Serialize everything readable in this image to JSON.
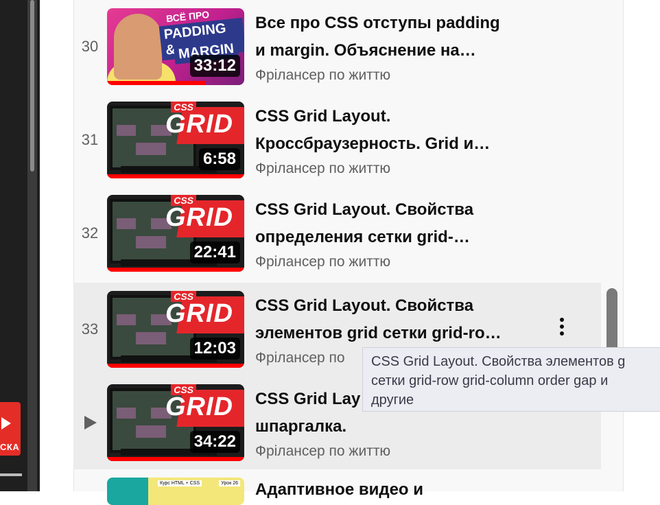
{
  "playlist": {
    "items": [
      {
        "index": "30",
        "title_line1": "Все про CSS отступы padding",
        "title_line2": "и margin. Объяснение на…",
        "channel": "Фрілансер по життю",
        "duration": "33:12",
        "thumb_top": "ВСЁ ПРО",
        "thumb_p1": "PADDING &",
        "thumb_p2": "MARGIN",
        "watched": 0.72
      },
      {
        "index": "31",
        "title_line1": "CSS Grid Layout.",
        "title_line2": "Кроссбраузерность. Grid и…",
        "channel": "Фрілансер по життю",
        "duration": "6:58",
        "thumb_css": "CSS",
        "thumb_grid": "GRID",
        "watched": 1.0
      },
      {
        "index": "32",
        "title_line1": "CSS Grid Layout. Свойства",
        "title_line2": "определения сетки grid-…",
        "channel": "Фрілансер по життю",
        "duration": "22:41",
        "thumb_css": "CSS",
        "thumb_grid": "GRID",
        "watched": 1.0
      },
      {
        "index": "33",
        "title_line1": "CSS Grid Layout. Свойства",
        "title_line2": "элементов grid сетки grid-ro…",
        "channel": "Фрілансер по ",
        "duration": "12:03",
        "thumb_css": "CSS",
        "thumb_grid": "GRID",
        "watched": 1.0
      },
      {
        "index": "",
        "title_line1": "CSS Grid Lay",
        "title_line2": "шпаргалка.",
        "channel": "Фрілансер по життю",
        "duration": "34:22",
        "thumb_css": "CSS",
        "thumb_grid": "GRID",
        "watched": 1.0,
        "playing": true
      },
      {
        "title_line1": "Адаптивное видео и",
        "thumb_tag": "Курс HTML + CSS",
        "thumb_tag2": "Урок 26"
      }
    ]
  },
  "tooltip": {
    "line1": "CSS Grid Layout. Свойства элементов g",
    "line2": "сетки grid-row grid-column order gap и",
    "line3": "другие"
  },
  "left": {
    "logo_text": "СКА"
  },
  "colors": {
    "accent_red": "#ff0000",
    "active_row_bg": "#ececec"
  },
  "icons": [
    "play-icon",
    "more-vert-icon",
    "youtube-logo-icon"
  ]
}
